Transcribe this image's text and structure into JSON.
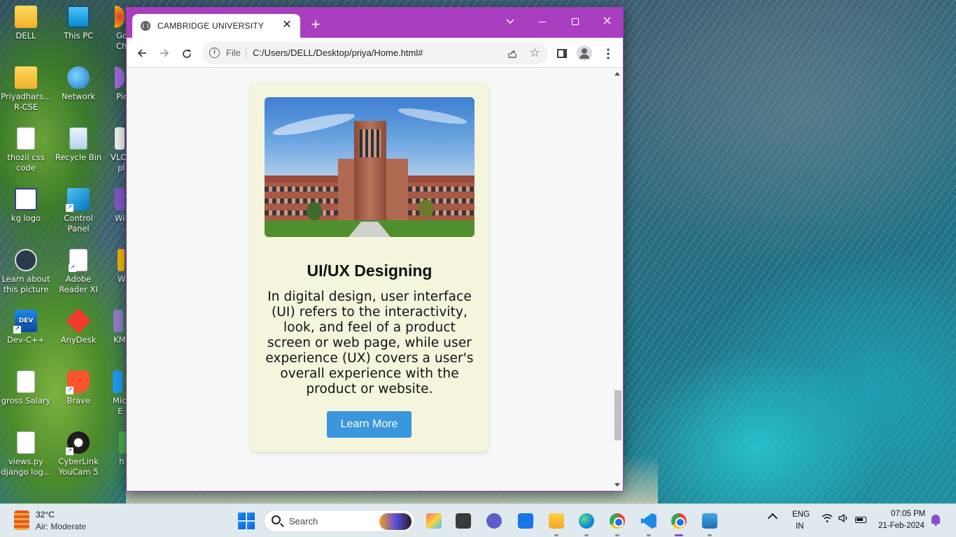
{
  "desktop": {
    "icons": [
      {
        "label": "DELL",
        "icon": "folder-icon"
      },
      {
        "label": "This PC",
        "icon": "computer-icon"
      },
      {
        "label": "Priyadhars... R-CSE",
        "icon": "folder-icon"
      },
      {
        "label": "Network",
        "icon": "network-icon"
      },
      {
        "label": "thozil css code",
        "icon": "document-icon"
      },
      {
        "label": "Recycle Bin",
        "icon": "recycle-bin-icon"
      },
      {
        "label": "kg logo",
        "icon": "image-icon"
      },
      {
        "label": "Control Panel",
        "icon": "control-panel-icon"
      },
      {
        "label": "Learn about this picture",
        "icon": "camera-icon"
      },
      {
        "label": "Adobe Reader XI",
        "icon": "pdf-icon"
      },
      {
        "label": "Dev-C++",
        "icon": "devcpp-icon"
      },
      {
        "label": "AnyDesk",
        "icon": "anydesk-icon"
      },
      {
        "label": "gross Salary",
        "icon": "document-icon"
      },
      {
        "label": "Brave",
        "icon": "brave-icon"
      },
      {
        "label": "views.py django log...",
        "icon": "document-icon"
      },
      {
        "label": "CyberLink YouCam 5",
        "icon": "webcam-icon"
      }
    ],
    "partial_labels": [
      "Go",
      "Ch",
      "Pic",
      "VLC",
      "pl",
      "Wi",
      "W",
      "KM",
      "Mic",
      "E",
      "h"
    ]
  },
  "browser": {
    "tab_title": "CAMBRIDGE UNIVERSITY",
    "tab_close": "✕",
    "new_tab": "+",
    "address": {
      "scheme_label": "File",
      "url": "C:/Users/DELL/Desktop/priya/Home.html#"
    },
    "accent_color": "#a93fc0"
  },
  "page": {
    "card": {
      "image_alt": "University building",
      "title": "UI/UX Designing",
      "description": "In digital design, user interface (UI) refers to the interactivity, look, and feel of a product screen or web page, while user experience (UX) covers a user's overall experience with the product or website.",
      "button_label": "Learn More",
      "background": "#f5f4dc",
      "button_color": "#3a96dd"
    }
  },
  "taskbar": {
    "weather": {
      "temp": "32°C",
      "desc": "Air: Moderate"
    },
    "search_label": "Search",
    "apps": [
      "pre-icon",
      "task-view-icon",
      "meet-icon",
      "mail-icon",
      "file-explorer-icon",
      "edge-icon",
      "chrome-profile-icon",
      "vscode-icon",
      "chrome-icon",
      "notepad-icon"
    ],
    "language": {
      "line1": "ENG",
      "line2": "IN"
    },
    "clock": {
      "time": "07:05 PM",
      "date": "21-Feb-2024"
    }
  }
}
